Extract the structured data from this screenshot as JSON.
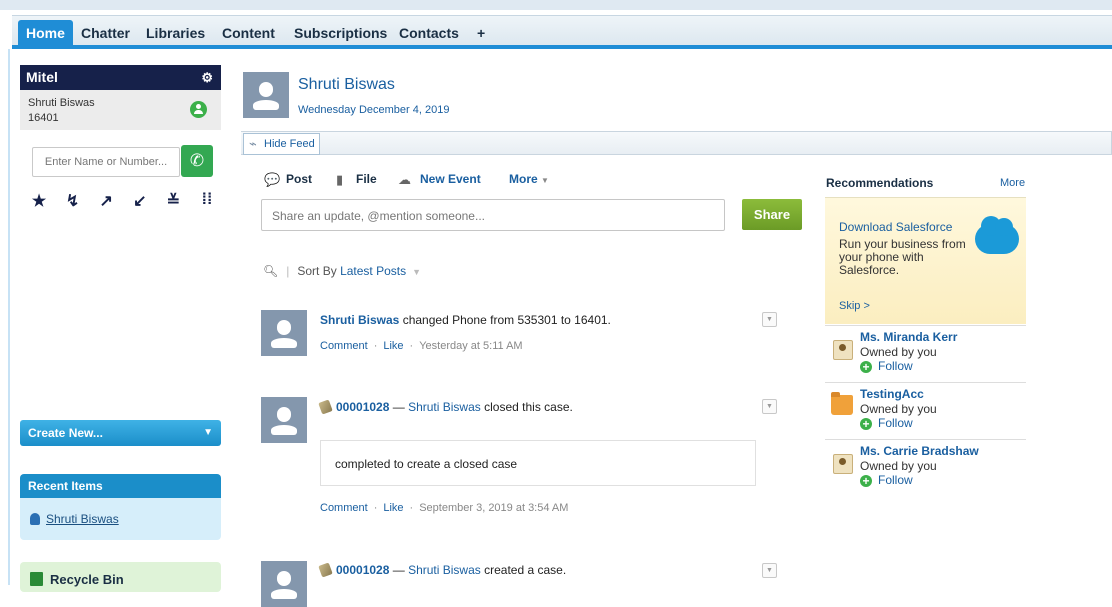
{
  "tabs": [
    "Home",
    "Chatter",
    "Libraries",
    "Content",
    "Subscriptions",
    "Contacts",
    "+"
  ],
  "mitel": {
    "brand": "Mitel",
    "user_name": "Shruti Biswas",
    "extension": "16401",
    "dial_placeholder": "Enter Name or Number..."
  },
  "sidebar": {
    "create_new": "Create New...",
    "recent_title": "Recent Items",
    "recent_items": [
      "Shruti Biswas"
    ],
    "recycle_bin": "Recycle Bin"
  },
  "profile": {
    "name": "Shruti Biswas",
    "date": "Wednesday December 4, 2019",
    "hide_feed": "Hide Feed"
  },
  "publisher": {
    "tabs": {
      "post": "Post",
      "file": "File",
      "new_event": "New Event",
      "more": "More"
    },
    "placeholder": "Share an update, @mention someone...",
    "share_button": "Share",
    "sort_label": "Sort By",
    "sort_value": "Latest Posts"
  },
  "feed": [
    {
      "actor": "Shruti Biswas",
      "text": "changed Phone from 535301 to 16401.",
      "comment": "Comment",
      "like": "Like",
      "time": "Yesterday at 5:11 AM"
    },
    {
      "case": "00001028",
      "dash": "—",
      "actor": "Shruti Biswas",
      "text": "closed this case.",
      "body": "completed to create a closed case",
      "comment": "Comment",
      "like": "Like",
      "time": "September 3, 2019 at 3:54 AM"
    },
    {
      "case": "00001028",
      "dash": "—",
      "actor": "Shruti Biswas",
      "text": "created a case."
    }
  ],
  "recommendations": {
    "title": "Recommendations",
    "more": "More",
    "promo": {
      "title": "Download Salesforce",
      "desc": "Run your business from your phone with Salesforce.",
      "skip": "Skip >"
    },
    "items": [
      {
        "name": "Ms. Miranda Kerr",
        "owner": "Owned by you",
        "follow": "Follow"
      },
      {
        "name": "TestingAcc",
        "owner": "Owned by you",
        "follow": "Follow"
      },
      {
        "name": "Ms. Carrie Bradshaw",
        "owner": "Owned by you",
        "follow": "Follow"
      }
    ]
  }
}
